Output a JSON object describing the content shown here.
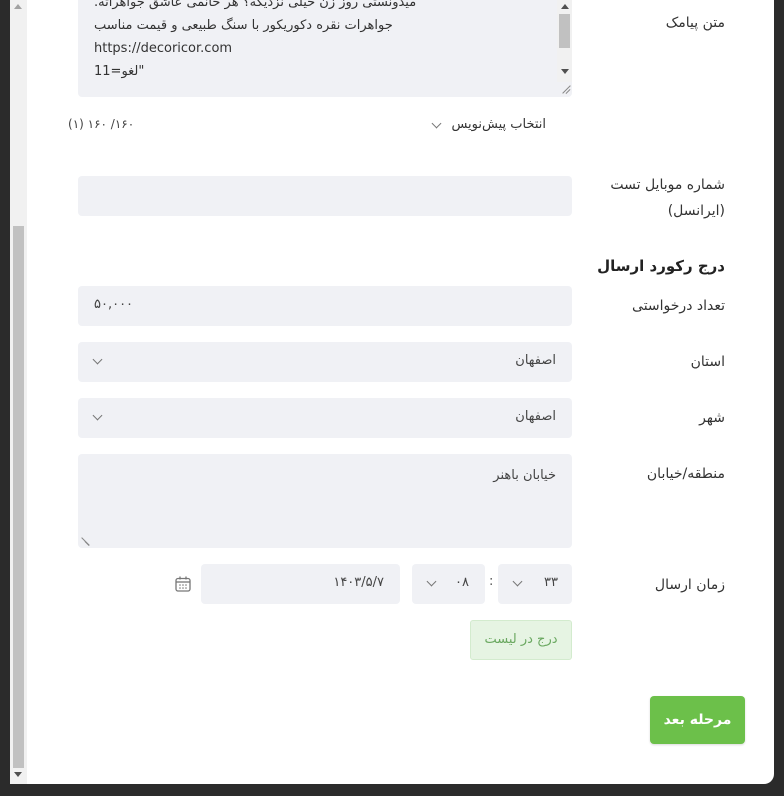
{
  "sms": {
    "label": "متن پیامک",
    "lines": [
      "میدونستی روز زن خیلی نزدیکه؟ هر خانمی عاشق جواهراته.",
      "جواهرات نقره دکوریکور با سنگ طبیعی و قیمت مناسب",
      "https://decoricor.com",
      "لغو=11\""
    ],
    "counter": "۱۶۰/ ۱۶۰ (۱)",
    "draft_select": "انتخاب پیش‌نویس"
  },
  "test_mobile": {
    "label_line1": "شماره موبایل تست",
    "label_line2": "(ایرانسل)",
    "value": ""
  },
  "record_section": {
    "title": "درج رکورد ارسال"
  },
  "request_count": {
    "label": "تعداد درخواستی",
    "value": "۵۰,۰۰۰"
  },
  "province": {
    "label": "استان",
    "value": "اصفهان"
  },
  "city": {
    "label": "شهر",
    "value": "اصفهان"
  },
  "area": {
    "label": "منطقه/خیابان",
    "value": "خیابان باهنر"
  },
  "send_time": {
    "label": "زمان ارسال",
    "date": "۱۴۰۳/۵/۷",
    "hour": "۰۸",
    "minute": "۳۳",
    "separator": ":"
  },
  "buttons": {
    "insert": "درج در لیست",
    "next": "مرحله بعد"
  },
  "colors": {
    "field_bg": "#f0f1f5",
    "primary_green": "#6cc04a",
    "insert_green_bg": "#e6f4e3"
  }
}
